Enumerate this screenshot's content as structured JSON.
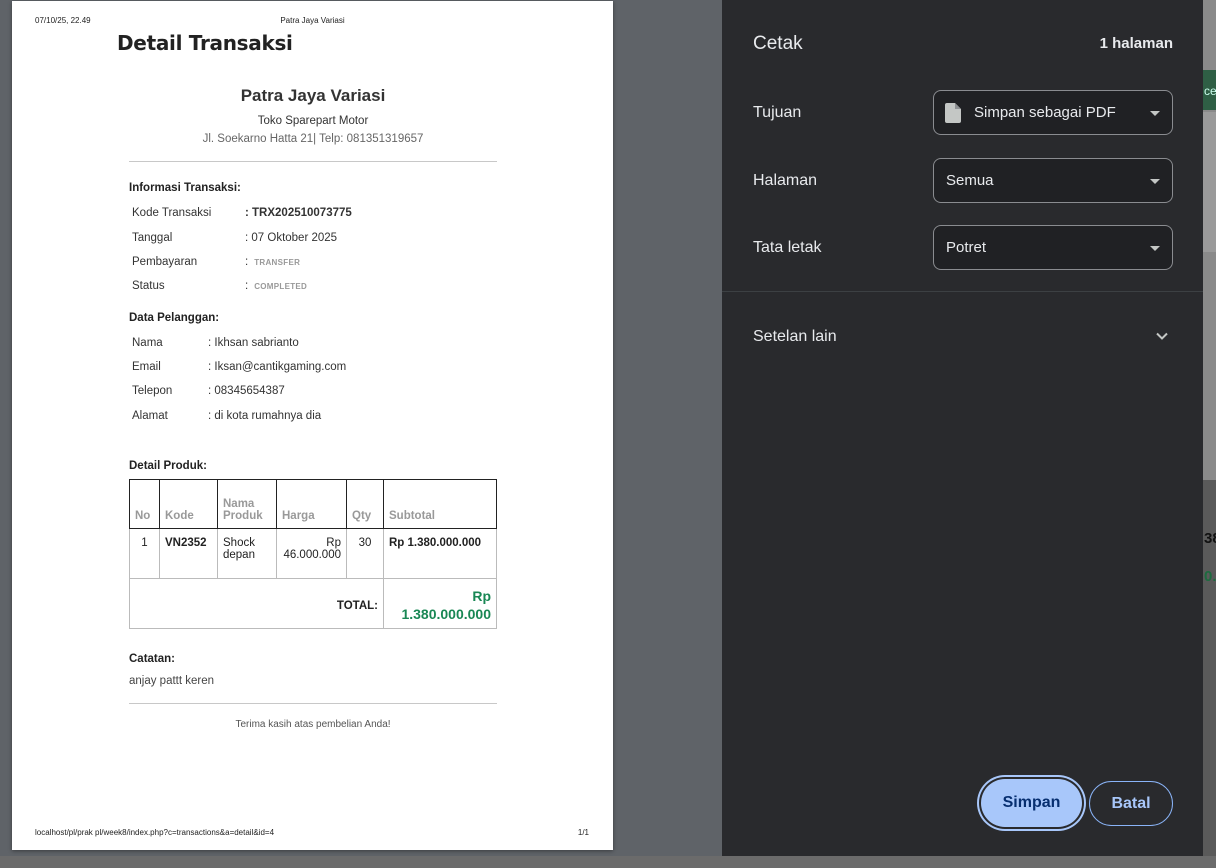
{
  "print_header": {
    "date": "07/10/25, 22.49",
    "title": "Patra Jaya Variasi"
  },
  "print_footer": {
    "url": "localhost/pl/prak pl/week8/index.php?c=transactions&a=detail&id=4",
    "page": "1/1"
  },
  "doc": {
    "title": "Detail Transaksi",
    "store_name": "Patra Jaya Variasi",
    "store_sub": "Toko Sparepart Motor",
    "store_addr": "Jl. Soekarno Hatta 21| Telp: 081351319657",
    "info_title": "Informasi Transaksi:",
    "info": [
      {
        "k": "Kode Transaksi",
        "v": ": TRX202510073775"
      },
      {
        "k": "Tanggal",
        "v": ": 07 Oktober 2025"
      },
      {
        "k": "Pembayaran",
        "v": ":",
        "badge": "TRANSFER"
      },
      {
        "k": "Status",
        "v": ":",
        "badge": "COMPLETED"
      }
    ],
    "customer_title": "Data Pelanggan:",
    "customer": [
      {
        "k": "Nama",
        "v": ": Ikhsan sabrianto"
      },
      {
        "k": "Email",
        "v": ": Iksan@cantikgaming.com"
      },
      {
        "k": "Telepon",
        "v": ": 08345654387"
      },
      {
        "k": "Alamat",
        "v": ": di kota rumahnya dia"
      }
    ],
    "products_title": "Detail Produk:",
    "table": {
      "headers": [
        "No",
        "Kode",
        "Nama Produk",
        "Harga",
        "Qty",
        "Subtotal"
      ],
      "rows": [
        [
          "1",
          "VN2352",
          "Shock depan",
          "Rp 46.000.000",
          "30",
          "Rp 1.380.000.000"
        ]
      ],
      "total_label": "TOTAL:",
      "total_value": "Rp 1.380.000.000"
    },
    "note_title": "Catatan:",
    "note_text": "anjay pattt keren",
    "thanks": "Terima kasih atas pembelian Anda!"
  },
  "panel": {
    "title": "Cetak",
    "pages": "1 halaman",
    "destination_label": "Tujuan",
    "destination_value": "Simpan sebagai PDF",
    "pages_label": "Halaman",
    "pages_value": "Semua",
    "layout_label": "Tata letak",
    "layout_value": "Potret",
    "more_settings": "Setelan lain",
    "save_button": "Simpan",
    "cancel_button": "Batal",
    "accent_color": "#a8c7fa"
  },
  "background_page": {
    "fragment_1": "ce",
    "fragment_2": "38",
    "fragment_3": "0."
  }
}
